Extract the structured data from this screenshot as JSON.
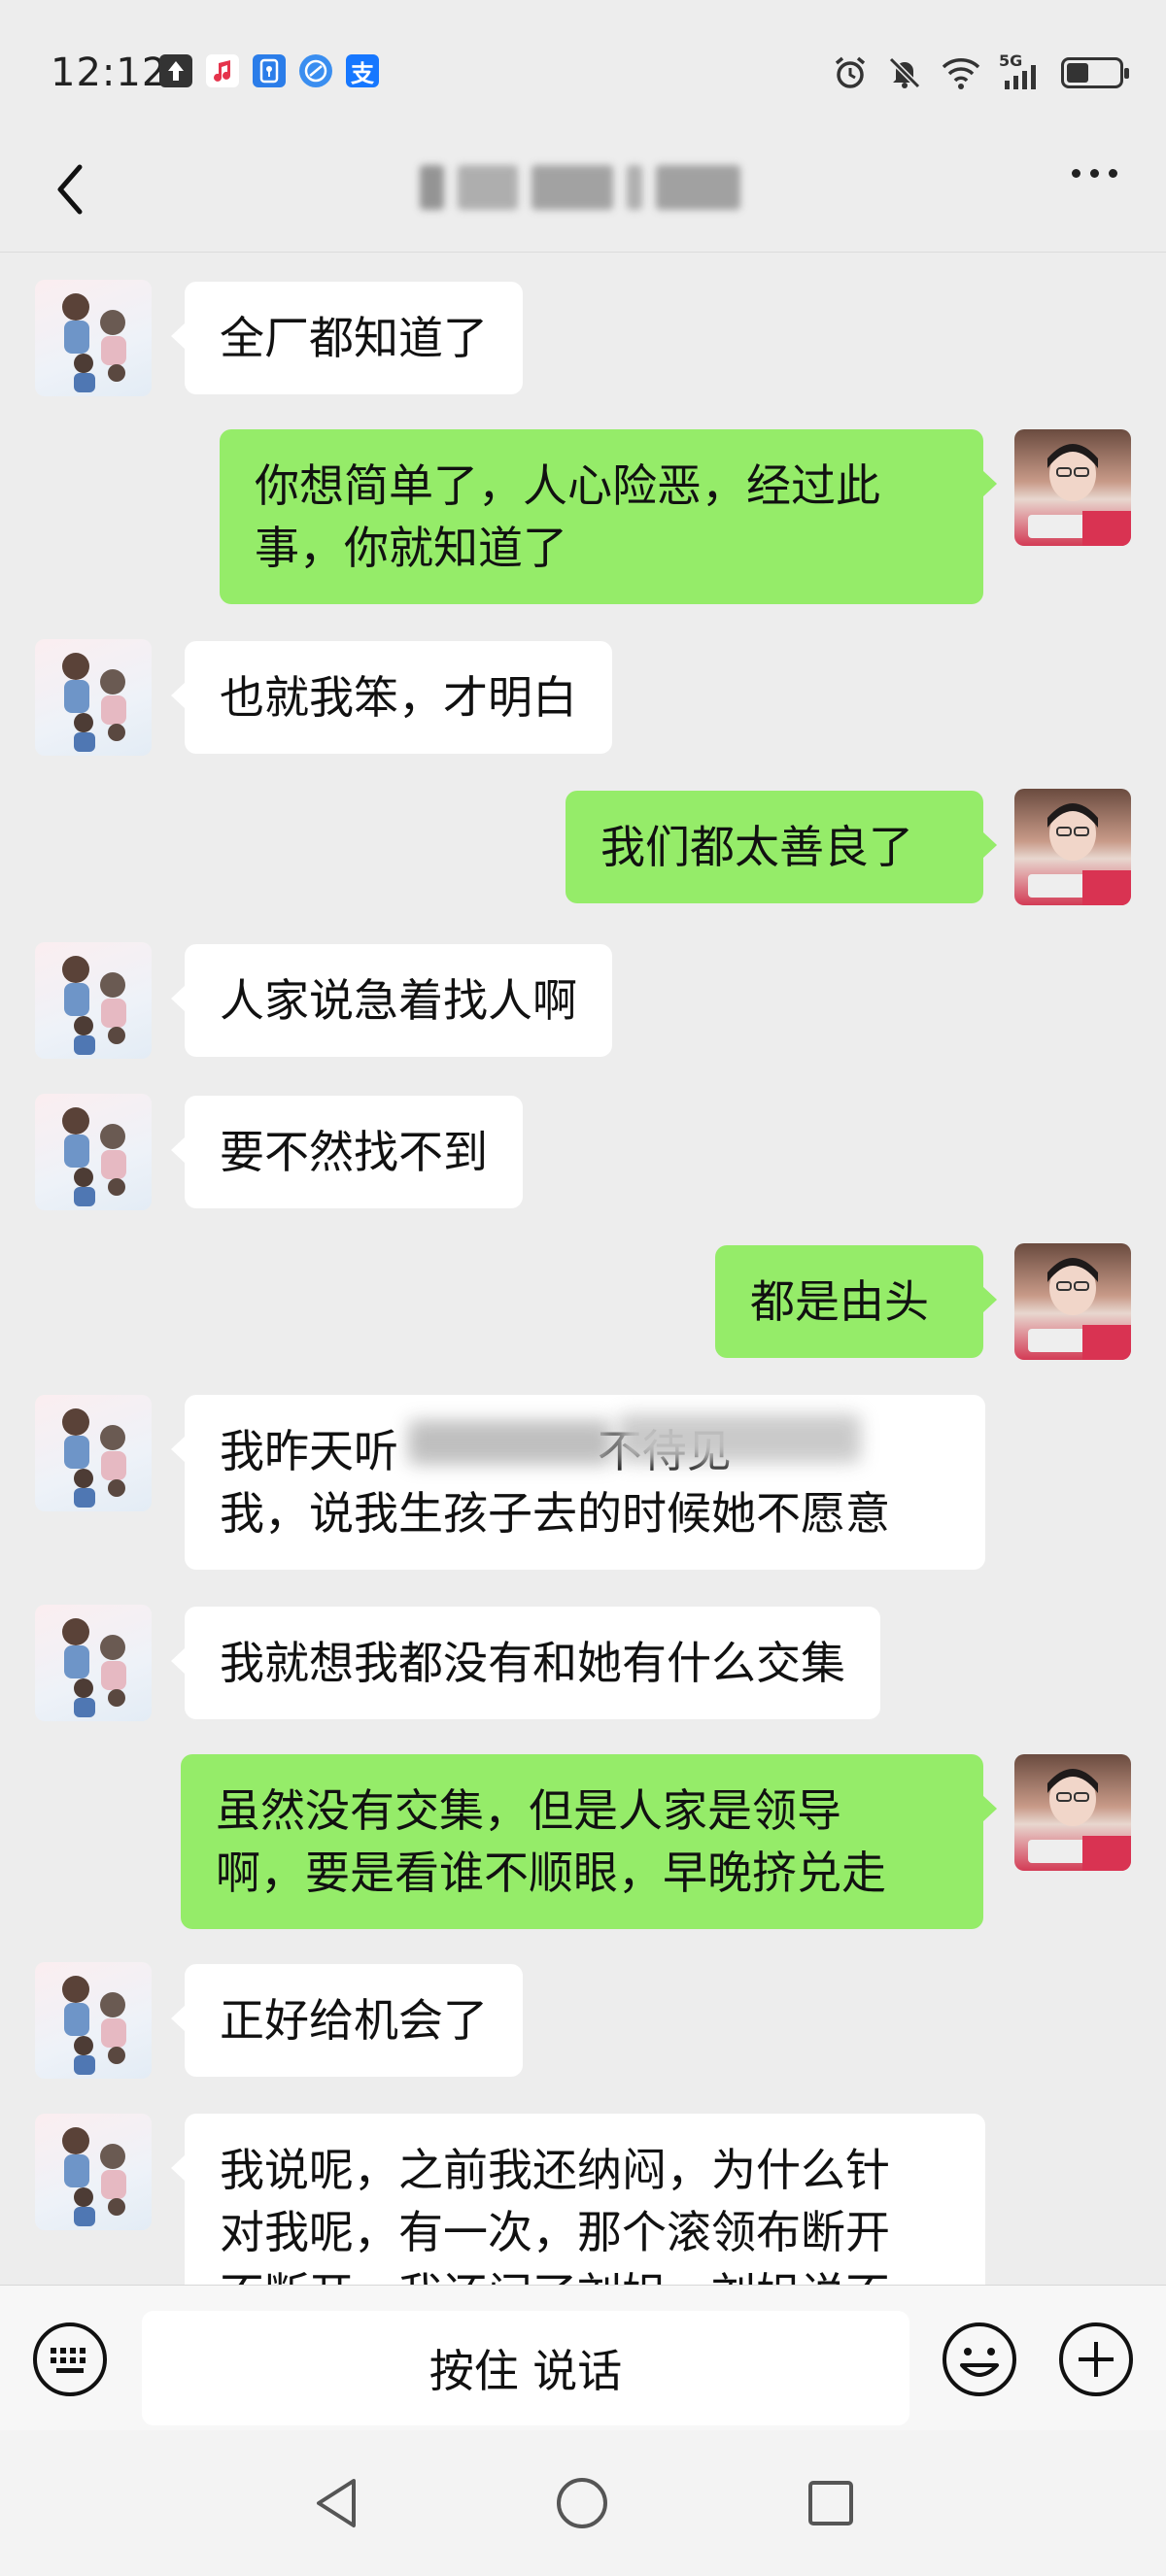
{
  "status_bar": {
    "time": "12:12",
    "left_icons": [
      "upload-icon",
      "music-icon",
      "keyhole-app-icon",
      "browser-icon",
      "alipay-icon"
    ],
    "right_icons": [
      "alarm-icon",
      "mute-icon",
      "wifi-icon",
      "signal-5g-icon",
      "battery-icon"
    ],
    "network_label": "5G"
  },
  "header": {
    "back_icon": "chevron-left-icon",
    "more_icon": "more-dots-icon"
  },
  "messages": [
    {
      "side": "other",
      "text": "全厂都知道了"
    },
    {
      "side": "self",
      "text": "你想简单了，人心险恶，经过此\n事，你就知道了"
    },
    {
      "side": "other",
      "text": "也就我笨，才明白"
    },
    {
      "side": "self",
      "text": "我们都太善良了"
    },
    {
      "side": "other",
      "text": "人家说急着找人啊"
    },
    {
      "side": "other",
      "text": "要不然找不到"
    },
    {
      "side": "self",
      "text": "都是由头"
    },
    {
      "side": "other",
      "text": "我昨天听              不待见\n我，说我生孩子去的时候她不愿意"
    },
    {
      "side": "other",
      "text": "我就想我都没有和她有什么交集"
    },
    {
      "side": "self",
      "text": "虽然没有交集，但是人家是领导\n啊，要是看谁不顺眼，早晚挤兑走"
    },
    {
      "side": "other",
      "text": "正好给机会了"
    },
    {
      "side": "other",
      "text": "我说呢，之前我还纳闷，为什么针\n对我呢，有一次，那个滚领布断开\n不断开，我还问了刘姐，刘姐说不"
    }
  ],
  "input_bar": {
    "voice_toggle_icon": "keyboard-icon",
    "hold_to_talk_label": "按住 说话",
    "emoji_icon": "emoji-icon",
    "add_icon": "plus-icon"
  },
  "nav_bar": {
    "icons": [
      "nav-back-icon",
      "nav-home-icon",
      "nav-recents-icon"
    ]
  }
}
